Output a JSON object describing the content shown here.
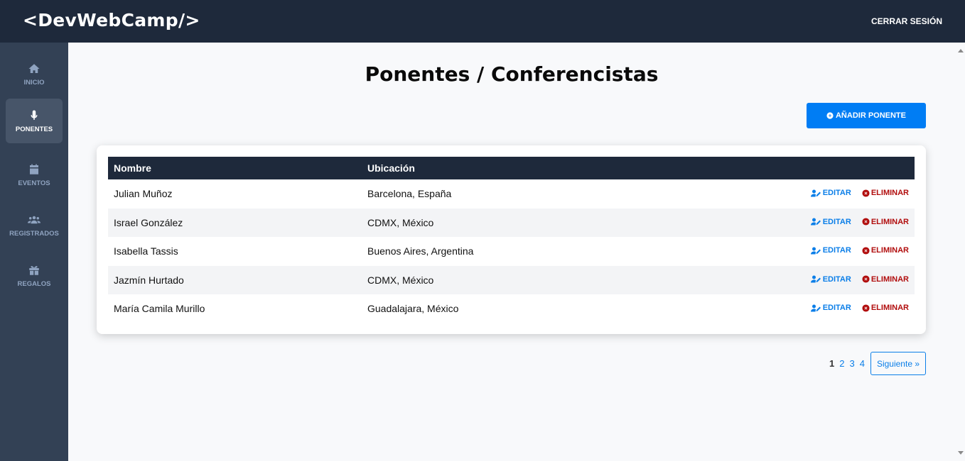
{
  "header": {
    "logo": "<DevWebCamp/>",
    "logout": "CERRAR SESIÓN"
  },
  "sidebar": {
    "items": [
      {
        "label": "INICIO",
        "icon": "home-icon",
        "active": false
      },
      {
        "label": "PONENTES",
        "icon": "microphone-icon",
        "active": true
      },
      {
        "label": "EVENTOS",
        "icon": "calendar-icon",
        "active": false
      },
      {
        "label": "REGISTRADOS",
        "icon": "users-icon",
        "active": false
      },
      {
        "label": "REGALOS",
        "icon": "gift-icon",
        "active": false
      }
    ]
  },
  "main": {
    "title": "Ponentes / Conferencistas",
    "add_button": "AÑADIR PONENTE",
    "table": {
      "headers": {
        "name": "Nombre",
        "location": "Ubicación"
      },
      "rows": [
        {
          "name": "Julian Muñoz",
          "location": "Barcelona, España"
        },
        {
          "name": "Israel González",
          "location": "CDMX, México"
        },
        {
          "name": "Isabella Tassis",
          "location": "Buenos Aires, Argentina"
        },
        {
          "name": "Jazmín Hurtado",
          "location": "CDMX, México"
        },
        {
          "name": "María Camila Murillo",
          "location": "Guadalajara, México"
        }
      ],
      "edit_label": "EDITAR",
      "delete_label": "ELIMINAR"
    },
    "pagination": {
      "pages": [
        "1",
        "2",
        "3",
        "4"
      ],
      "current": "1",
      "next": "Siguiente »"
    }
  },
  "colors": {
    "header_bg": "#1e293b",
    "sidebar_bg": "#334155",
    "accent": "#007df4",
    "danger": "#b10d0d"
  }
}
